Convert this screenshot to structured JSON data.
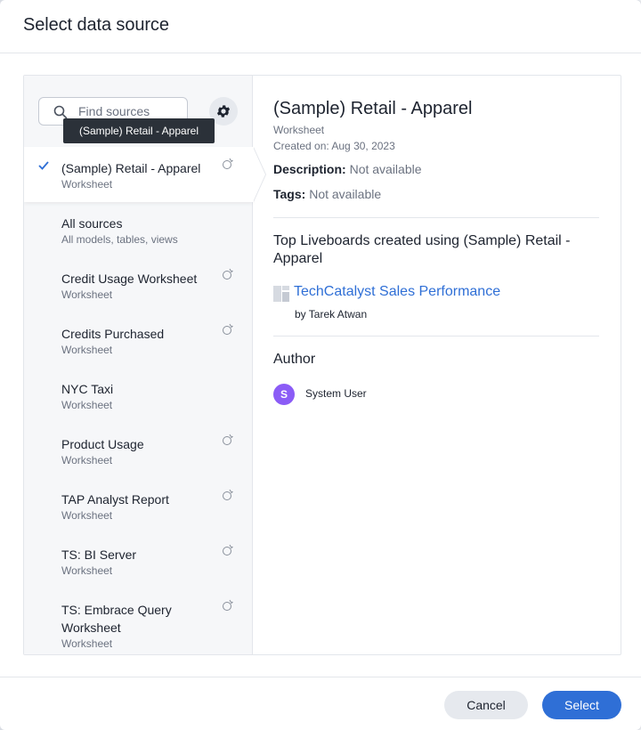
{
  "dialog": {
    "title": "Select data source"
  },
  "search": {
    "placeholder": "Find sources"
  },
  "tooltip": "(Sample) Retail - Apparel",
  "sources": [
    {
      "name": "(Sample) Retail - Apparel",
      "sub": "Worksheet",
      "selected": true,
      "badge": true
    },
    {
      "name": "All sources",
      "sub": "All models, tables, views",
      "selected": false,
      "badge": false
    },
    {
      "name": "Credit Usage Worksheet",
      "sub": "Worksheet",
      "selected": false,
      "badge": true
    },
    {
      "name": "Credits Purchased",
      "sub": "Worksheet",
      "selected": false,
      "badge": true
    },
    {
      "name": "NYC Taxi",
      "sub": "Worksheet",
      "selected": false,
      "badge": false
    },
    {
      "name": "Product Usage",
      "sub": "Worksheet",
      "selected": false,
      "badge": true
    },
    {
      "name": "TAP Analyst Report",
      "sub": "Worksheet",
      "selected": false,
      "badge": true
    },
    {
      "name": "TS: BI Server",
      "sub": "Worksheet",
      "selected": false,
      "badge": true
    },
    {
      "name": "TS: Embrace Query Worksheet",
      "sub": "Worksheet",
      "selected": false,
      "badge": true
    }
  ],
  "details": {
    "title": "(Sample) Retail - Apparel",
    "type": "Worksheet",
    "created": "Created on: Aug 30, 2023",
    "description_label": "Description:",
    "description_value": "Not available",
    "tags_label": "Tags:",
    "tags_value": "Not available",
    "liveboards_heading": "Top Liveboards created using (Sample) Retail - Apparel",
    "liveboard_name": "TechCatalyst Sales Performance",
    "liveboard_by": "by Tarek Atwan",
    "author_heading": "Author",
    "author_initial": "S",
    "author_name": "System User"
  },
  "footer": {
    "cancel_label": "Cancel",
    "select_label": "Select"
  },
  "colors": {
    "accent": "#2f6fd6",
    "avatar": "#8b5cf6"
  }
}
